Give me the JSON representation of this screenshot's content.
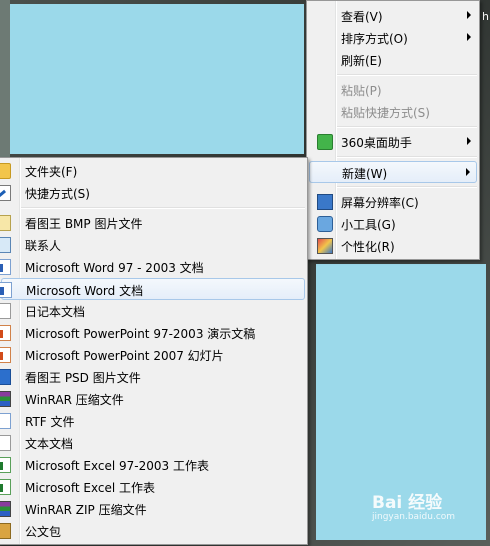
{
  "desktop": {
    "corner_char": "h",
    "watermark_text": "Bai 经验",
    "watermark_url": "jingyan.baidu.com"
  },
  "main_menu": {
    "items": [
      {
        "label": "查看(V)",
        "submenu": true,
        "disabled": false
      },
      {
        "label": "排序方式(O)",
        "submenu": true,
        "disabled": false
      },
      {
        "label": "刷新(E)",
        "submenu": false,
        "disabled": false
      },
      {
        "label": "粘贴(P)",
        "submenu": false,
        "disabled": true
      },
      {
        "label": "粘贴快捷方式(S)",
        "submenu": false,
        "disabled": true
      },
      {
        "label": "360桌面助手",
        "submenu": true,
        "disabled": false,
        "icon": "360-desktop-icon"
      },
      {
        "label": "新建(W)",
        "submenu": true,
        "disabled": false,
        "highlighted": true
      },
      {
        "label": "屏幕分辨率(C)",
        "submenu": false,
        "disabled": false,
        "icon": "screen-resolution-icon"
      },
      {
        "label": "小工具(G)",
        "submenu": false,
        "disabled": false,
        "icon": "gadgets-icon"
      },
      {
        "label": "个性化(R)",
        "submenu": false,
        "disabled": false,
        "icon": "personalize-icon"
      }
    ]
  },
  "new_submenu": {
    "items": [
      {
        "label": "文件夹(F)",
        "icon": "folder-icon"
      },
      {
        "label": "快捷方式(S)",
        "icon": "shortcut-icon"
      },
      {
        "label": "看图王 BMP 图片文件",
        "icon": "bmp-file-icon"
      },
      {
        "label": "联系人",
        "icon": "contact-icon"
      },
      {
        "label": "Microsoft Word 97 - 2003 文档",
        "icon": "word-doc-icon"
      },
      {
        "label": "Microsoft Word 文档",
        "icon": "word-doc-icon",
        "highlighted": true
      },
      {
        "label": "日记本文档",
        "icon": "journal-doc-icon"
      },
      {
        "label": "Microsoft PowerPoint 97-2003 演示文稿",
        "icon": "powerpoint-icon"
      },
      {
        "label": "Microsoft PowerPoint 2007 幻灯片",
        "icon": "powerpoint-icon"
      },
      {
        "label": "看图王 PSD 图片文件",
        "icon": "psd-file-icon"
      },
      {
        "label": "WinRAR 压缩文件",
        "icon": "winrar-icon"
      },
      {
        "label": "RTF 文件",
        "icon": "rtf-file-icon"
      },
      {
        "label": "文本文档",
        "icon": "text-doc-icon"
      },
      {
        "label": "Microsoft Excel 97-2003 工作表",
        "icon": "excel-icon"
      },
      {
        "label": "Microsoft Excel 工作表",
        "icon": "excel-icon"
      },
      {
        "label": "WinRAR ZIP 压缩文件",
        "icon": "winrar-zip-icon"
      },
      {
        "label": "公文包",
        "icon": "briefcase-icon"
      }
    ]
  }
}
